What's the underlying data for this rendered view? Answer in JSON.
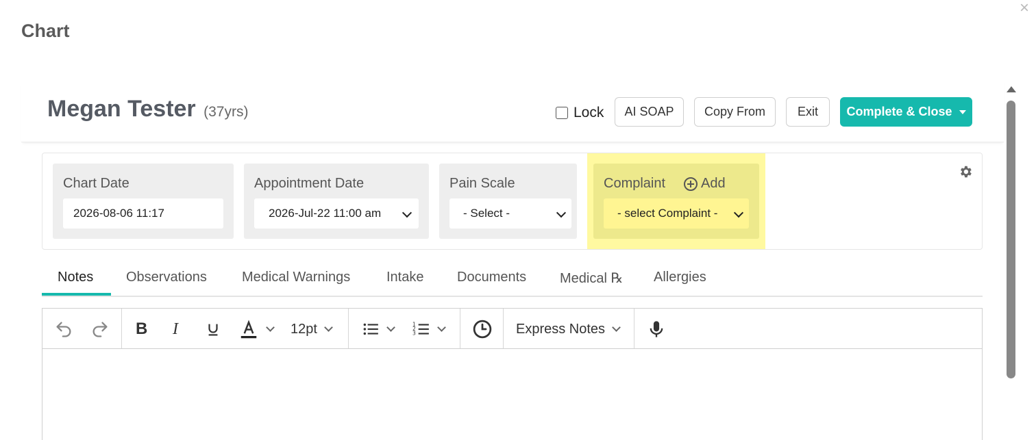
{
  "modal": {
    "title": "Chart",
    "close": "×"
  },
  "patient": {
    "name": "Megan Tester",
    "age": "(37yrs)"
  },
  "header": {
    "lock_label": "Lock",
    "ai_soap": "AI SOAP",
    "copy_from": "Copy From",
    "exit": "Exit",
    "complete_close": "Complete & Close"
  },
  "fields": {
    "chart_date": {
      "label": "Chart Date",
      "value": "2026-08-06 11:17"
    },
    "appointment_date": {
      "label": "Appointment Date",
      "value": "2026-Jul-22 11:00 am"
    },
    "pain_scale": {
      "label": "Pain Scale",
      "value": "- Select -"
    },
    "complaint": {
      "label": "Complaint",
      "add_label": "Add",
      "value": "- select Complaint -"
    }
  },
  "tabs": [
    {
      "label": "Notes",
      "active": true
    },
    {
      "label": "Observations"
    },
    {
      "label": "Medical Warnings"
    },
    {
      "label": "Intake"
    },
    {
      "label": "Documents"
    },
    {
      "label": "Medical ℞"
    },
    {
      "label": "Allergies"
    }
  ],
  "toolbar": {
    "font_size": "12pt",
    "express_notes": "Express Notes",
    "icons": [
      "undo-icon",
      "redo-icon",
      "bold-icon",
      "italic-icon",
      "underline-icon",
      "text-color-icon",
      "bullet-list-icon",
      "numbered-list-icon",
      "clock-icon",
      "microphone-icon"
    ]
  },
  "colors": {
    "accent": "#16b9ad",
    "highlight": "#fff9a0"
  }
}
